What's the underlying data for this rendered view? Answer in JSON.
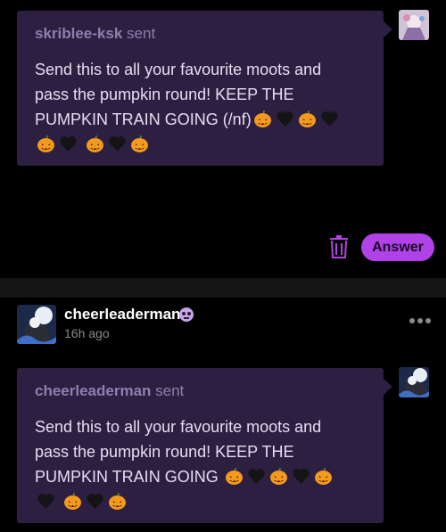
{
  "post1": {
    "sender": "skriblee-ksk",
    "sent_label": "sent",
    "message_lines": [
      "Send this to all your favourite moots and",
      "pass the pumpkin round! KEEP THE",
      "PUMPKIN TRAIN GOING (/nf)"
    ]
  },
  "actions": {
    "answer_label": "Answer",
    "trash_icon": "trash-icon"
  },
  "post2": {
    "blog_name": "cheerleaderman",
    "time_ago": "16h ago",
    "sender": "cheerleaderman",
    "sent_label": "sent",
    "message_lines": [
      "Send this to all your favourite moots and",
      "pass the pumpkin round! KEEP THE",
      "PUMPKIN TRAIN GOING"
    ]
  },
  "colors": {
    "bubble": "#2d1f42",
    "accent": "#b042e8",
    "muted": "#8f7fae"
  }
}
